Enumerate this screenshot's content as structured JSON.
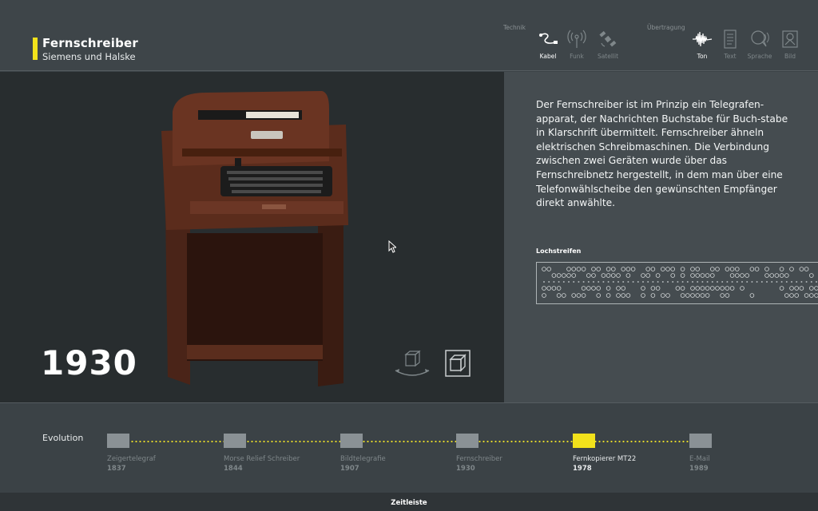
{
  "header": {
    "title": "Fernschreiber",
    "subtitle": "Siemens und Halske",
    "groups": {
      "technik": "Technik",
      "uebertragung": "Übertragung"
    },
    "technik_items": [
      {
        "label": "Kabel",
        "icon": "cable-icon",
        "active": true
      },
      {
        "label": "Funk",
        "icon": "radio-icon",
        "active": false
      },
      {
        "label": "Satellit",
        "icon": "satellite-icon",
        "active": false
      }
    ],
    "uebertragung_items": [
      {
        "label": "Ton",
        "icon": "waveform-icon",
        "active": true
      },
      {
        "label": "Text",
        "icon": "document-icon",
        "active": false
      },
      {
        "label": "Sprache",
        "icon": "speech-icon",
        "active": false
      },
      {
        "label": "Bild",
        "icon": "image-icon",
        "active": false
      }
    ]
  },
  "main": {
    "year": "1930",
    "description": "Der Fernschreiber ist im Prinzip ein Telegrafen-apparat, der Nachrichten Buchstabe für Buch-stabe in Klarschrift übermittelt. Fernschreiber ähneln elektrischen Schreibmaschinen. Die Verbindung zwischen zwei Geräten wurde über das Fernschreibnetz hergestellt, in dem man über eine Telefonwählscheibe den gewünschten Empfänger direkt anwählte.",
    "tape_label": "Lochstreifen"
  },
  "evolution": {
    "label": "Evolution",
    "items": [
      {
        "name": "Zeigertelegraf",
        "year": "1837",
        "active": false
      },
      {
        "name": "Morse Relief Schreiber",
        "year": "1844",
        "active": false
      },
      {
        "name": "Bildtelegrafie",
        "year": "1907",
        "active": false
      },
      {
        "name": "Fernschreiber",
        "year": "1930",
        "active": false
      },
      {
        "name": "Fernkopierer MT22",
        "year": "1978",
        "active": true
      },
      {
        "name": "E-Mail",
        "year": "1989",
        "active": false
      }
    ]
  },
  "footer": {
    "label": "Zeitleiste"
  },
  "colors": {
    "accent": "#f2e21b",
    "background": "#3b4246",
    "photo_panel": "#282d2f",
    "text_panel": "#454c50"
  }
}
